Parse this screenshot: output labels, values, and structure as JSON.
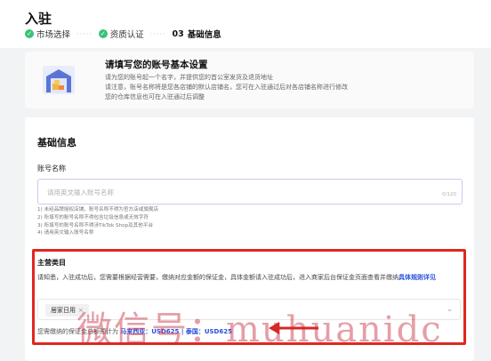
{
  "page": {
    "title": "入驻"
  },
  "steps": [
    {
      "label": "市场选择",
      "state": "done"
    },
    {
      "label": "资质认证",
      "state": "done"
    },
    {
      "number": "03",
      "label": "基础信息",
      "state": "current"
    }
  ],
  "intro": {
    "icon": "warehouse-icon",
    "title": "请填写您的账号基本设置",
    "lines": [
      "请为您的账号起一个名字，并提供您的首公室发货及退货地址",
      "请注意，账号名称将是您各店铺的默认店铺名，您可在入驻通过后对各店铺名称进行修改",
      "您的仓库信息也可在入驻通过后调整"
    ]
  },
  "form": {
    "section_title": "基础信息",
    "account_name_label": "账号名称",
    "account_name_placeholder": "请用英文输入账号名称",
    "account_name_counter": "0/120",
    "rules": [
      "1) 未经品牌授权店铺，账号名称不得为官方店或旗舰店",
      "2) 所填写的账号名称不得包含垃圾信息或无效字符",
      "3) 所填写的账号名称不得涉TikTok Shop及其他平台",
      "4) 请用英文输入账号名称"
    ],
    "category_label": "主营类目",
    "category_desc": "请知悉，入驻成功后，您需要根据经营需要，缴纳对应金额的保证金，具体金额请入驻成功后，进入商家后台保证金页面查看并缴纳",
    "category_link": "具体规则详见",
    "selected_category": "居家日用",
    "deposit_prefix": "您需缴纳的保证金总额预计为",
    "deposit_values": "马来西亚：USD625 | 泰国：USD625"
  },
  "watermark": "微信号：muhuanidc",
  "colors": {
    "accent_red": "#e0271f",
    "link_blue": "#2850d9",
    "check_green": "#3cc17a"
  }
}
